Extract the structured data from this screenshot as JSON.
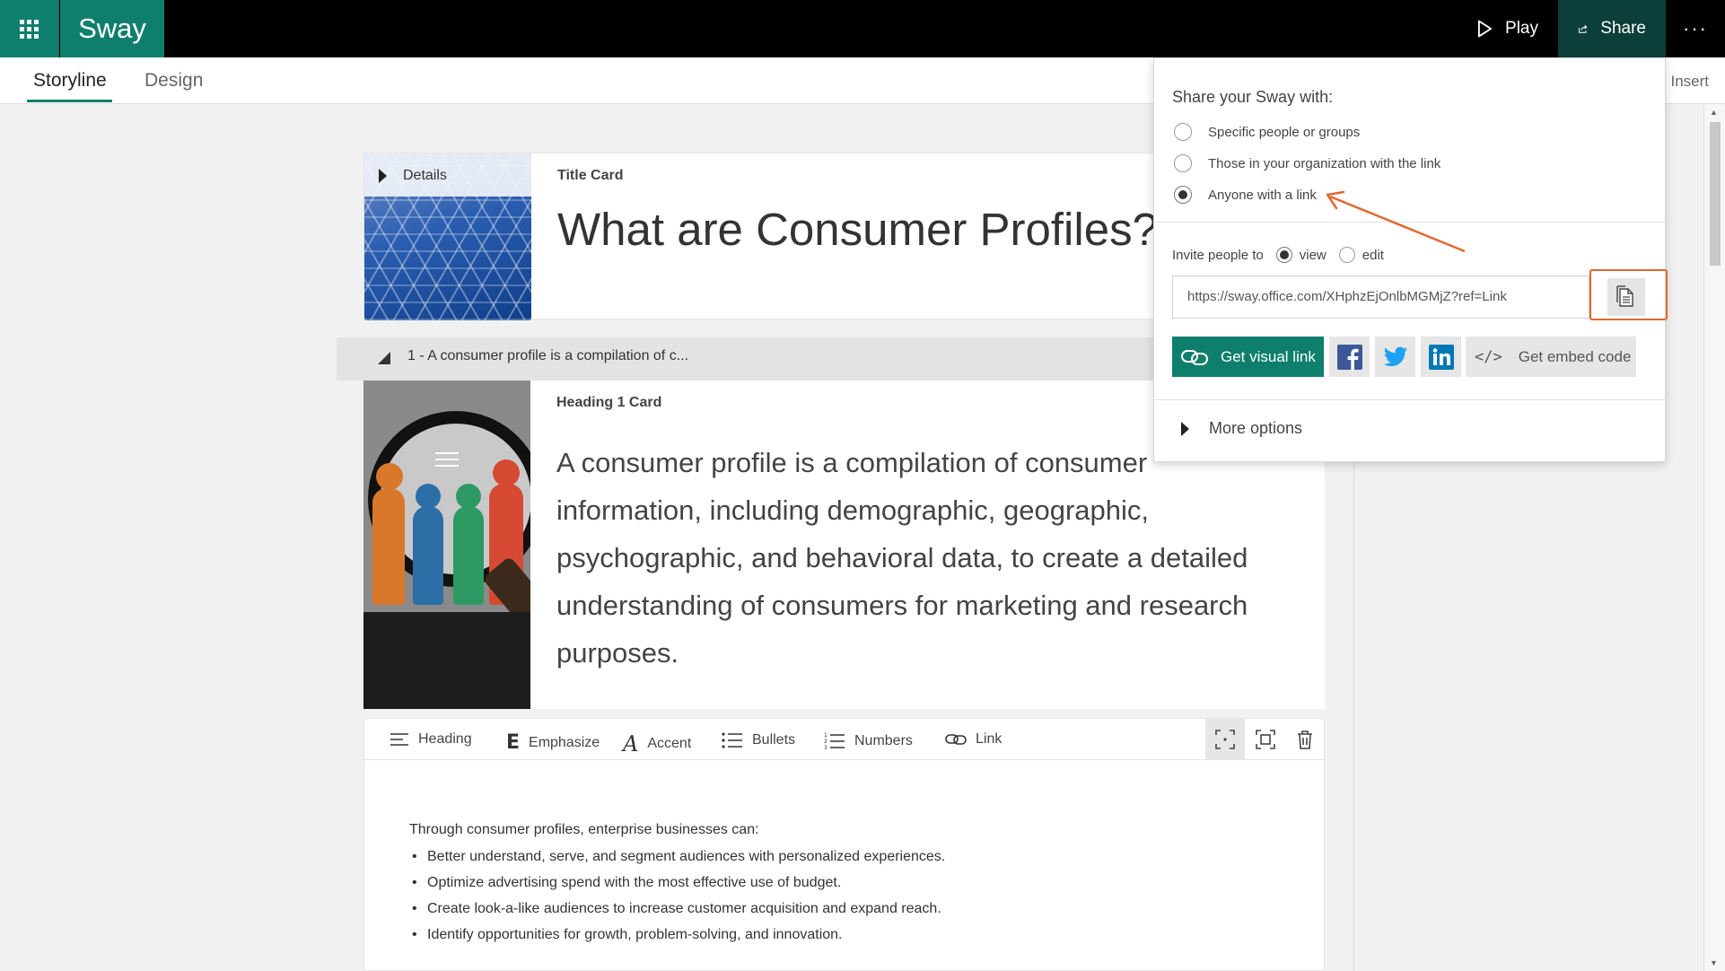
{
  "app": {
    "brand": "Sway",
    "play_label": "Play",
    "share_label": "Share",
    "more_label": "···"
  },
  "nav": {
    "tabs": [
      {
        "label": "Storyline"
      },
      {
        "label": "Design"
      }
    ],
    "insert_label": "Insert"
  },
  "title_card": {
    "details_label": "Details",
    "card_label": "Title Card",
    "title": "What are Consumer Profiles?"
  },
  "section": {
    "label": "1 - A consumer profile is a compilation of c..."
  },
  "heading_card": {
    "card_label": "Heading 1 Card",
    "text": "A consumer profile is a compilation of consumer information, including demographic, geographic, psychographic, and behavioral data, to create a detailed understanding of consumers for marketing and research purposes."
  },
  "editor": {
    "tools": [
      {
        "label": "Heading",
        "icon": "heading-icon"
      },
      {
        "label": "Emphasize",
        "icon": "emphasize-icon"
      },
      {
        "label": "Accent",
        "icon": "accent-icon"
      },
      {
        "label": "Bullets",
        "icon": "bullets-icon"
      },
      {
        "label": "Numbers",
        "icon": "numbers-icon"
      },
      {
        "label": "Link",
        "icon": "link-icon"
      }
    ],
    "intro": "Through consumer profiles, enterprise businesses can:",
    "bullets": [
      "Better understand, serve, and segment audiences with personalized experiences.",
      "Optimize advertising spend with the most effective use of budget.",
      "Create look-a-like audiences to increase customer acquisition and expand reach.",
      "Identify opportunities for growth, problem-solving, and innovation."
    ]
  },
  "share_panel": {
    "title": "Share your Sway with:",
    "options": [
      {
        "label": "Specific people or groups",
        "selected": false
      },
      {
        "label": "Those in your organization with the link",
        "selected": false
      },
      {
        "label": "Anyone with a link",
        "selected": true
      }
    ],
    "invite_label": "Invite people to",
    "invite_view": "view",
    "invite_edit": "edit",
    "invite_selected": "view",
    "link": "https://sway.office.com/XHphzEjOnlbMGMjZ?ref=Link",
    "visual_link_label": "Get visual link",
    "embed_label": "Get embed code",
    "embed_glyph": "</>",
    "more_options_label": "More options"
  },
  "colors": {
    "accent": "#0e7f6c",
    "highlight": "#e2672f"
  }
}
